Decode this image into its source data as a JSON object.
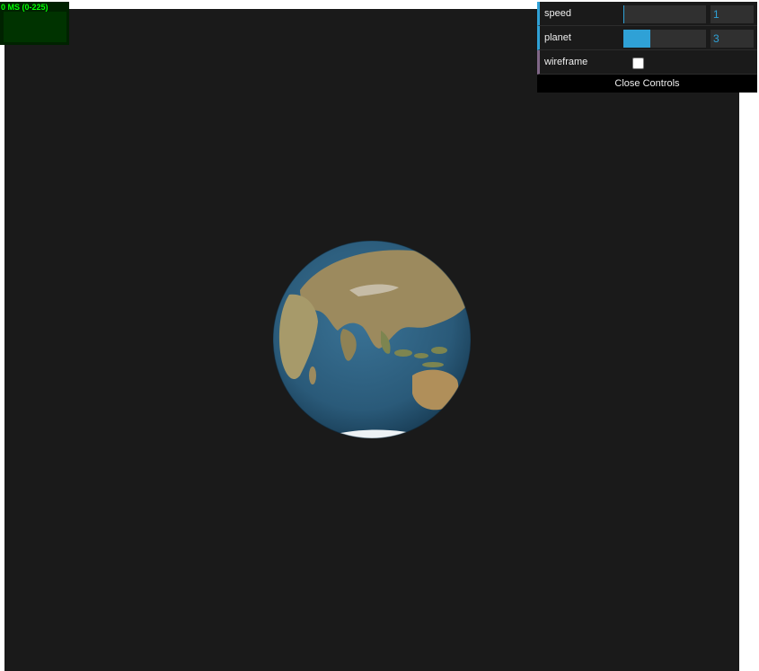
{
  "stats": {
    "label": "0 MS (0-225)"
  },
  "gui": {
    "controls": [
      {
        "name": "speed",
        "value": "1",
        "slider_fraction": 0.01
      },
      {
        "name": "planet",
        "value": "3",
        "slider_fraction": 0.33
      },
      {
        "name": "wireframe",
        "checked": false
      }
    ],
    "close_label": "Close Controls"
  },
  "colors": {
    "canvas_background": "#1a1a1a",
    "number_accent": "#2fa1d6",
    "boolean_accent": "#806787",
    "ocean": "#2e5f7f",
    "land": "#a08a5c",
    "stats_text": "#00ff00"
  },
  "scene": {
    "object": "earth-globe"
  }
}
